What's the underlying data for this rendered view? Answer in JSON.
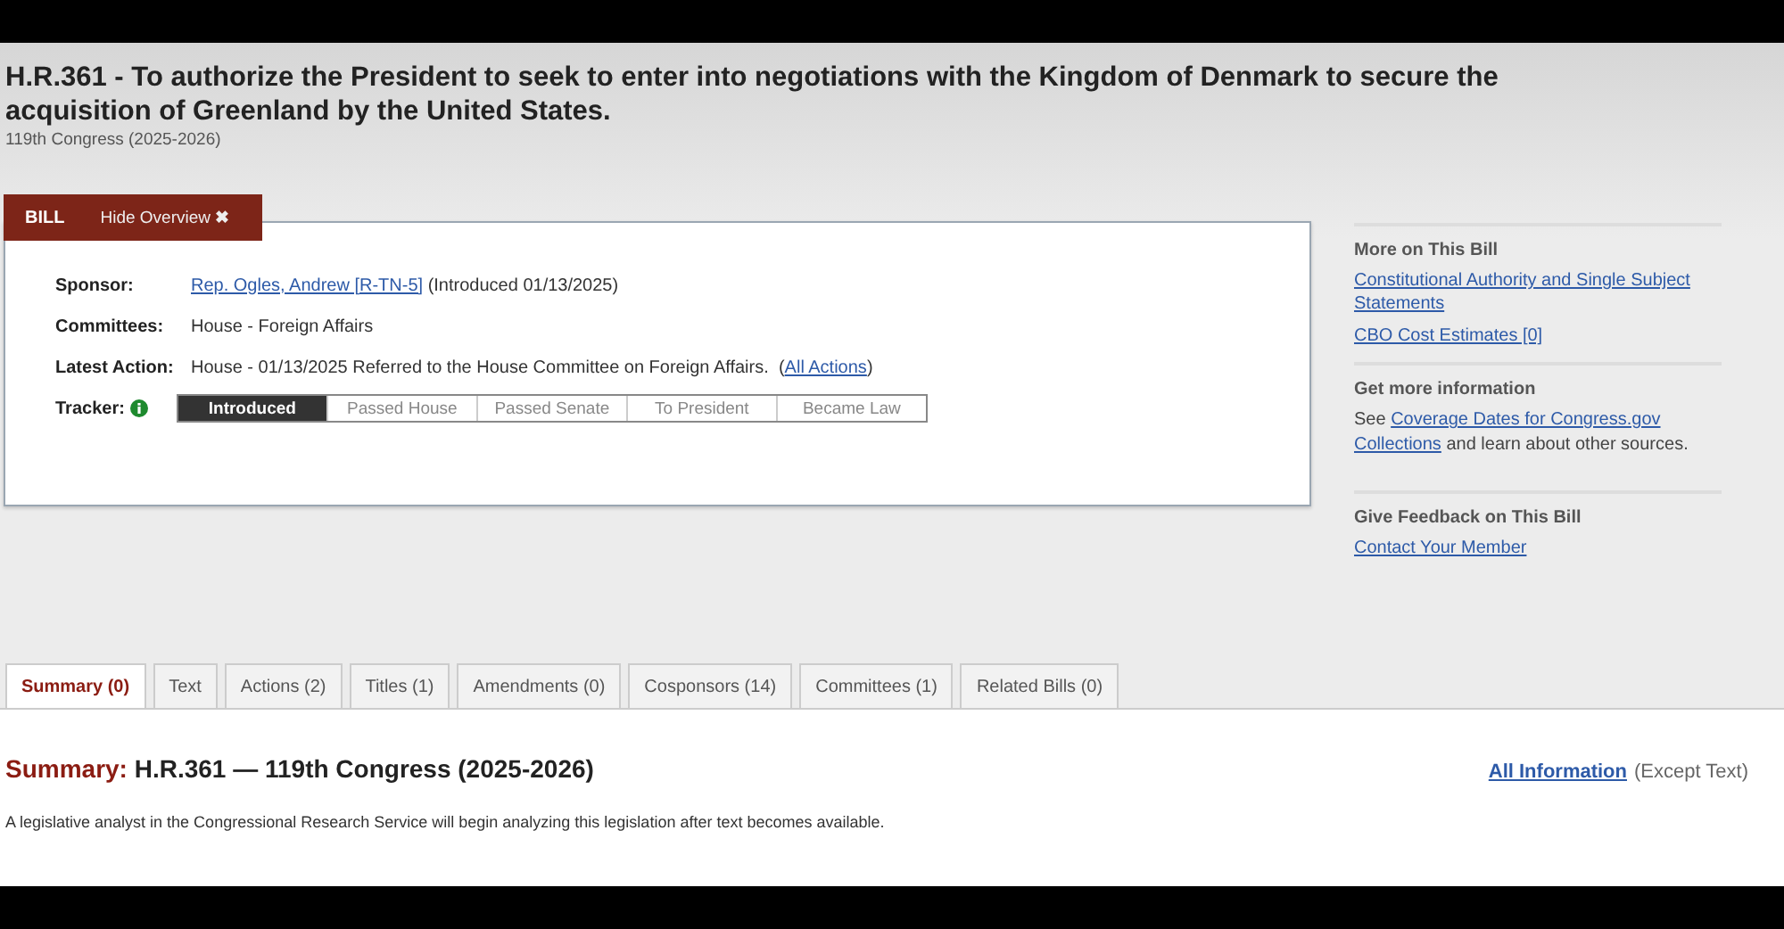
{
  "bill": {
    "title": "H.R.361 - To authorize the President to seek to enter into negotiations with the Kingdom of Denmark to secure the acquisition of Greenland by the United States.",
    "congress": "119th Congress (2025-2026)"
  },
  "overview_tabs": {
    "label": "BILL",
    "toggle": "Hide Overview",
    "toggle_icon": "✖"
  },
  "overview": {
    "rows": [
      {
        "kind": "sponsor",
        "label": "Sponsor:",
        "link": "Rep. Ogles, Andrew [R-TN-5]",
        "text": "(Introduced 01/13/2025)"
      },
      {
        "kind": "plain",
        "label": "Committees:",
        "text": "House - Foreign Affairs"
      },
      {
        "kind": "action",
        "label": "Latest Action:",
        "text": "House - 01/13/2025 Referred to the House Committee on Foreign Affairs.",
        "link": "All Actions",
        "open": "(",
        "close": ")"
      }
    ],
    "tracker": {
      "label": "Tracker:",
      "steps": [
        {
          "label": "Introduced",
          "selected": true
        },
        {
          "label": "Passed House",
          "selected": false
        },
        {
          "label": "Passed Senate",
          "selected": false
        },
        {
          "label": "To President",
          "selected": false
        },
        {
          "label": "Became Law",
          "selected": false
        }
      ]
    }
  },
  "sidebar": [
    {
      "heading": "More on This Bill",
      "links": [
        "Constitutional Authority and Single Subject Statements",
        "CBO Cost Estimates [0]"
      ]
    },
    {
      "heading": "Get more information",
      "before": "See",
      "link_lines": [
        "Coverage Dates for Congress.gov",
        "Collections"
      ],
      "after": "and learn about other sources."
    },
    {
      "heading": "Give Feedback on This Bill",
      "links": [
        "Contact Your Member"
      ]
    }
  ],
  "tabs": [
    {
      "label": "Summary (0)",
      "selected": true
    },
    {
      "label": "Text",
      "selected": false
    },
    {
      "label": "Actions (2)",
      "selected": false
    },
    {
      "label": "Titles (1)",
      "selected": false
    },
    {
      "label": "Amendments (0)",
      "selected": false
    },
    {
      "label": "Cosponsors (14)",
      "selected": false
    },
    {
      "label": "Committees (1)",
      "selected": false
    },
    {
      "label": "Related Bills (0)",
      "selected": false
    }
  ],
  "summary": {
    "heading_label": "Summary:",
    "heading": "H.R.361 — 119th Congress (2025-2026)",
    "all_info_link": "All Information",
    "all_info_note": "(Except Text)",
    "text": "A legislative analyst in the Congressional Research Service will begin analyzing this legislation after text becomes available."
  }
}
